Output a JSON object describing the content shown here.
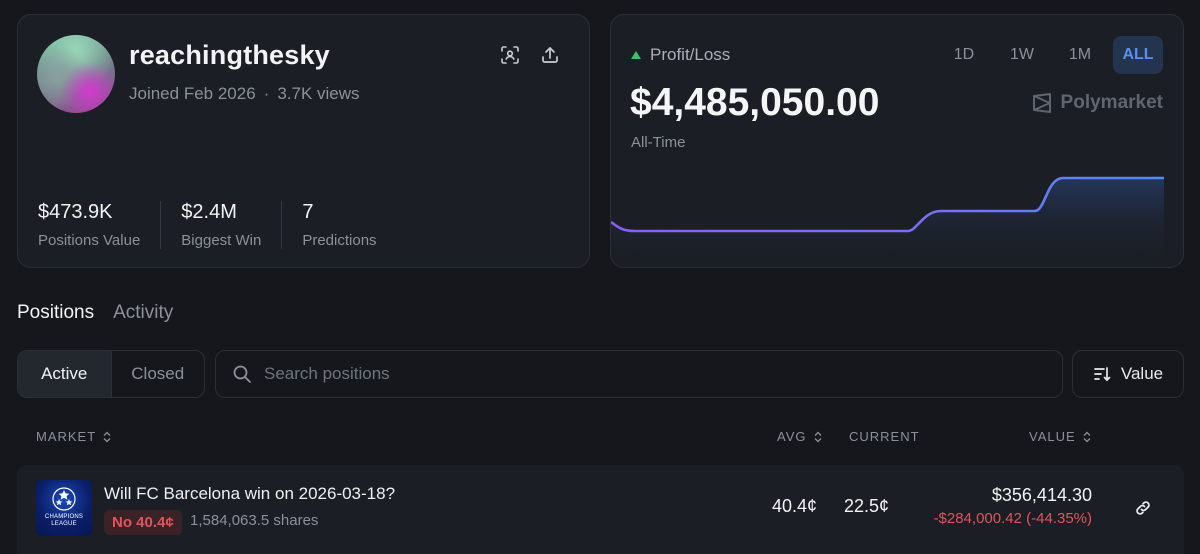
{
  "profile": {
    "username": "reachingthesky",
    "joined": "Joined Feb 2026",
    "separator": "·",
    "views": "3.7K views",
    "stats": [
      {
        "value": "$473.9K",
        "label": "Positions Value"
      },
      {
        "value": "$2.4M",
        "label": "Biggest Win"
      },
      {
        "value": "7",
        "label": "Predictions"
      }
    ],
    "icons": [
      "scan-icon",
      "share-icon"
    ]
  },
  "pnl": {
    "label": "Profit/Loss",
    "value": "$4,485,050.00",
    "period_label": "All-Time",
    "ranges": [
      "1D",
      "1W",
      "1M",
      "ALL"
    ],
    "active_range": "ALL",
    "brand": "Polymarket",
    "colors": {
      "up": "#3fbf6b",
      "line_start": "#8b5cf6",
      "line_end": "#4f8df7",
      "active_range_bg": "#23344f"
    }
  },
  "tabs": {
    "items": [
      "Positions",
      "Activity"
    ],
    "active": "Positions"
  },
  "filters": {
    "segments": [
      "Active",
      "Closed"
    ],
    "active_segment": "Active",
    "search_placeholder": "Search positions",
    "sort_label": "Value"
  },
  "table": {
    "headers": {
      "market": "MARKET",
      "avg": "AVG",
      "current": "CURRENT",
      "value": "VALUE"
    },
    "rows": [
      {
        "thumb_text": "CHAMPIONS LEAGUE",
        "title": "Will FC Barcelona win on 2026-03-18?",
        "outcome": "No 40.4¢",
        "shares": "1,584,063.5 shares",
        "avg": "40.4¢",
        "current": "22.5¢",
        "value": "$356,414.30",
        "pnl": "-$284,000.42 (-44.35%)"
      }
    ]
  }
}
